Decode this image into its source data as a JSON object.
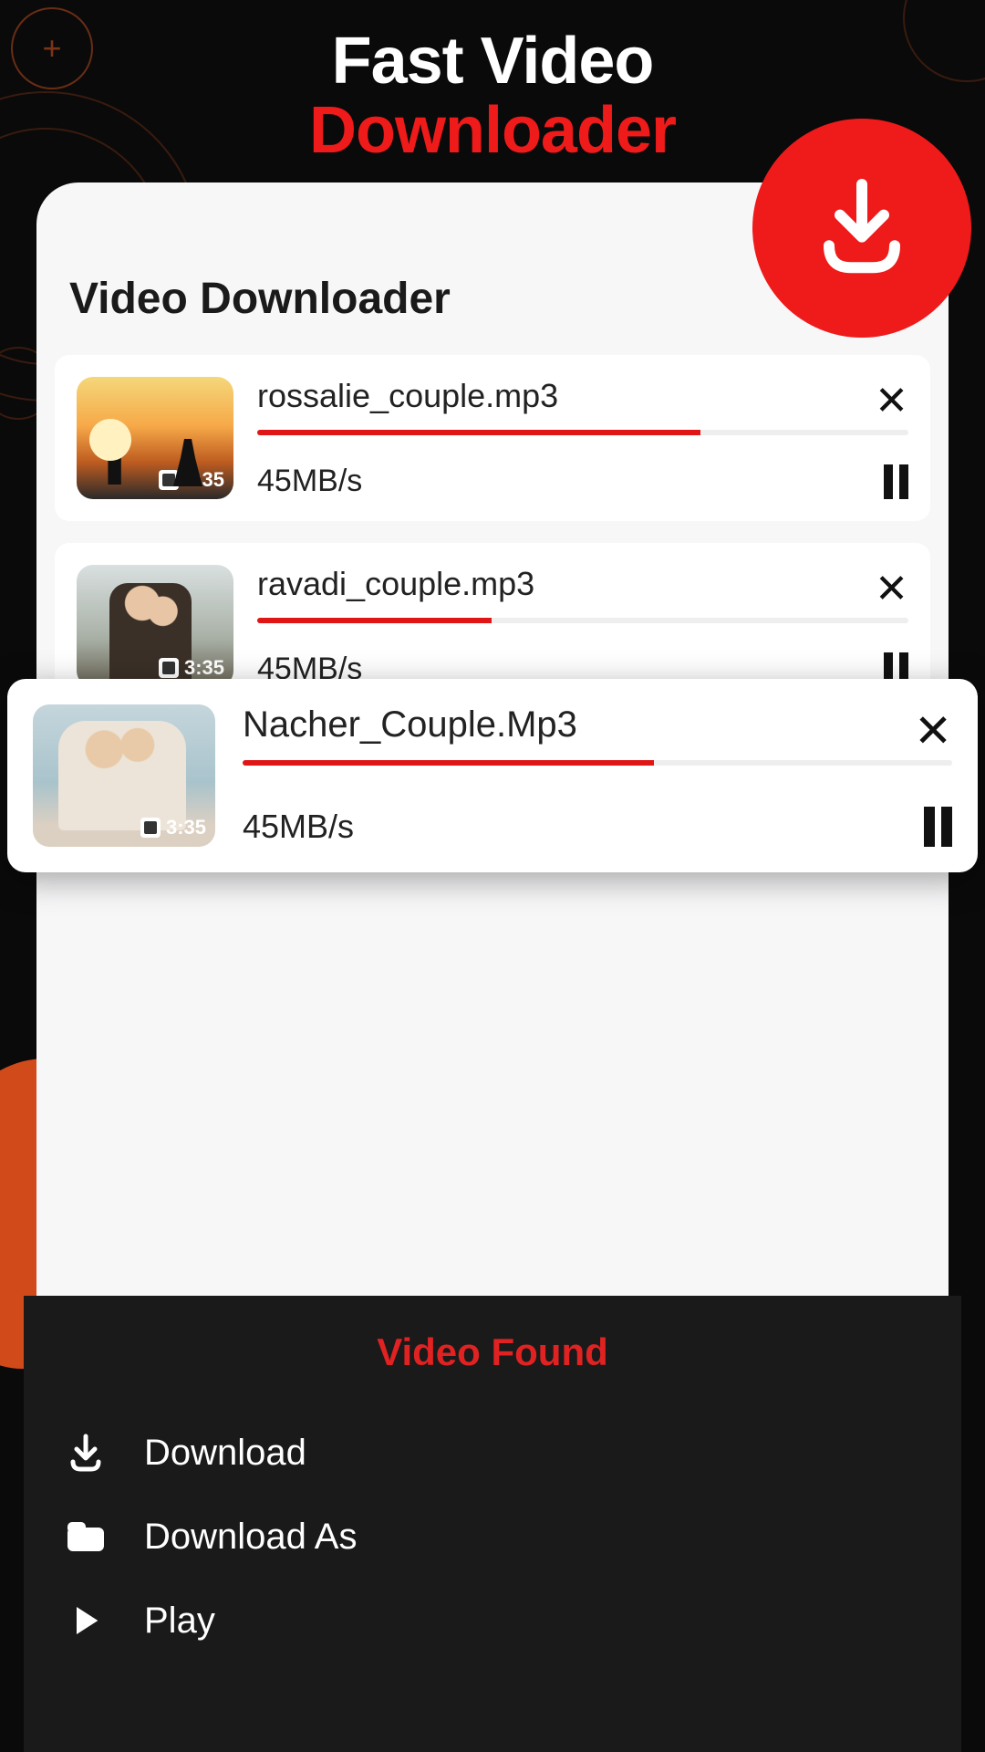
{
  "header": {
    "line1": "Fast Video",
    "line2": "Downloader"
  },
  "main": {
    "title": "Video Downloader"
  },
  "items": [
    {
      "name": "rossalie_couple.mp3",
      "speed": "45MB/s",
      "duration": "3:35",
      "progress": 68
    },
    {
      "name": "ravadi_couple.mp3",
      "speed": "45MB/s",
      "duration": "3:35",
      "progress": 36
    }
  ],
  "highlight": {
    "name": "Nacher_Couple.Mp3",
    "speed": "45MB/s",
    "duration": "3:35",
    "progress": 58
  },
  "sheet": {
    "title": "Video Found",
    "options": {
      "download": "Download",
      "download_as": "Download As",
      "play": "Play"
    }
  }
}
